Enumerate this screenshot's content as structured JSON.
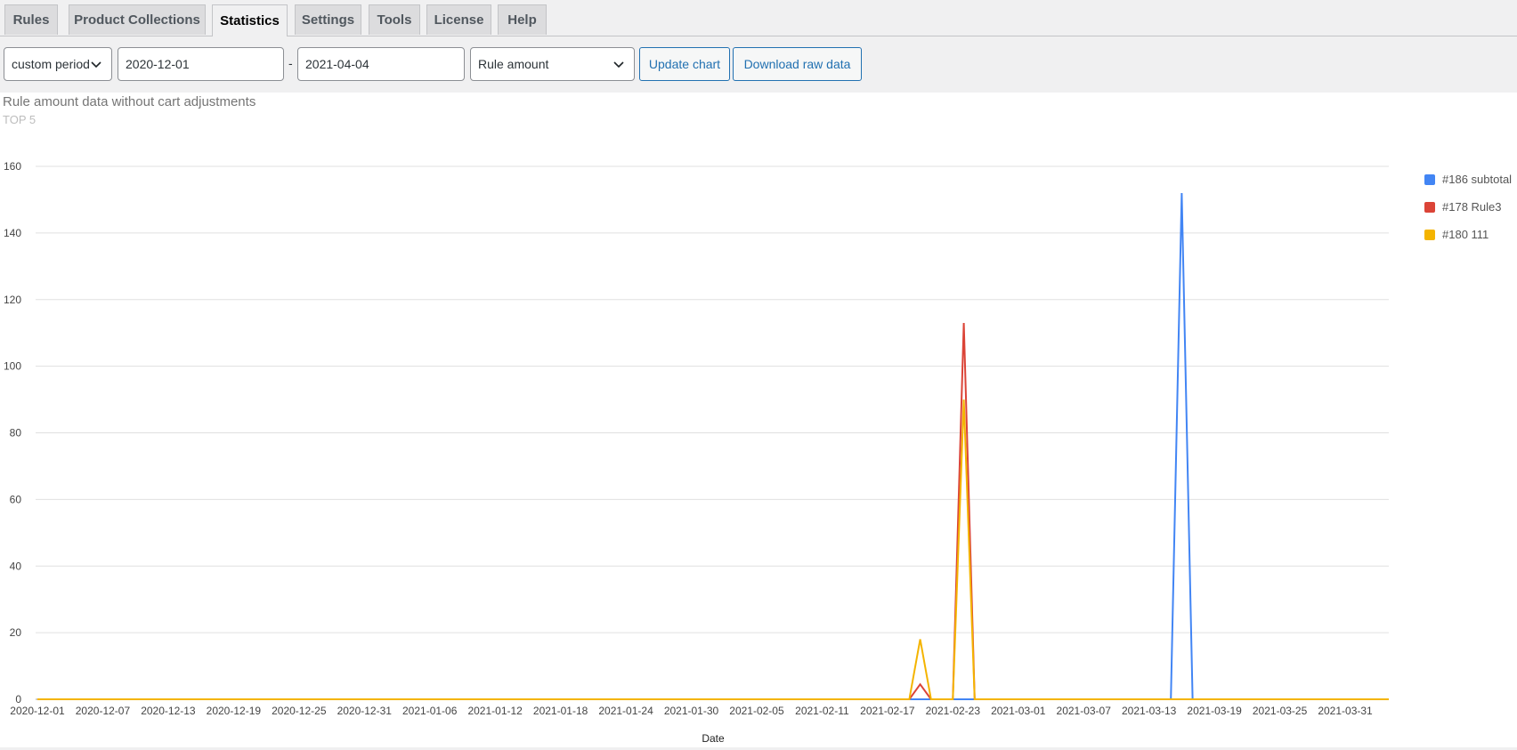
{
  "tabs": [
    {
      "label": "Rules",
      "active": false
    },
    {
      "label": "Product Collections",
      "active": false
    },
    {
      "label": "Statistics",
      "active": true
    },
    {
      "label": "Settings",
      "active": false
    },
    {
      "label": "Tools",
      "active": false
    },
    {
      "label": "License",
      "active": false
    },
    {
      "label": "Help",
      "active": false
    }
  ],
  "toolbar": {
    "period_select": "custom period",
    "date_from": "2020-12-01",
    "date_separator": "-",
    "date_to": "2021-04-04",
    "metric_select": "Rule amount",
    "update_button": "Update chart",
    "download_button": "Download raw data"
  },
  "colors": {
    "series_blue": "#4285f4",
    "series_red": "#db4437",
    "series_yellow": "#f4b400",
    "button_accent": "#2271b1"
  },
  "chart_data": {
    "type": "line",
    "title": "Rule amount data without cart adjustments",
    "subtitle": "TOP 5",
    "xlabel": "Date",
    "ylabel": "",
    "ylim": [
      0,
      160
    ],
    "yticks": [
      0,
      20,
      40,
      60,
      80,
      100,
      120,
      140,
      160
    ],
    "xticks": [
      "2020-12-01",
      "2020-12-07",
      "2020-12-13",
      "2020-12-19",
      "2020-12-25",
      "2020-12-31",
      "2021-01-06",
      "2021-01-12",
      "2021-01-18",
      "2021-01-24",
      "2021-01-30",
      "2021-02-05",
      "2021-02-11",
      "2021-02-17",
      "2021-02-23",
      "2021-03-01",
      "2021-03-07",
      "2021-03-13",
      "2021-03-19",
      "2021-03-25",
      "2021-03-31"
    ],
    "x_range": [
      "2020-12-01",
      "2021-04-04"
    ],
    "grid": true,
    "legend_position": "right",
    "series": [
      {
        "name": "#186 subtotal",
        "color": "#4285f4",
        "points": [
          [
            "2020-12-01",
            0
          ],
          [
            "2021-03-15",
            0
          ],
          [
            "2021-03-16",
            152
          ],
          [
            "2021-03-17",
            0
          ],
          [
            "2021-04-04",
            0
          ]
        ]
      },
      {
        "name": "#178 Rule3",
        "color": "#db4437",
        "points": [
          [
            "2020-12-01",
            0
          ],
          [
            "2021-02-19",
            0
          ],
          [
            "2021-02-20",
            4.5
          ],
          [
            "2021-02-21",
            0
          ],
          [
            "2021-02-23",
            0
          ],
          [
            "2021-02-24",
            113
          ],
          [
            "2021-02-25",
            0
          ],
          [
            "2021-04-04",
            0
          ]
        ]
      },
      {
        "name": "#180 111",
        "color": "#f4b400",
        "points": [
          [
            "2020-12-01",
            0
          ],
          [
            "2021-02-19",
            0
          ],
          [
            "2021-02-20",
            18
          ],
          [
            "2021-02-21",
            0
          ],
          [
            "2021-02-23",
            0
          ],
          [
            "2021-02-24",
            90
          ],
          [
            "2021-02-25",
            0
          ],
          [
            "2021-04-04",
            0
          ]
        ]
      }
    ]
  }
}
